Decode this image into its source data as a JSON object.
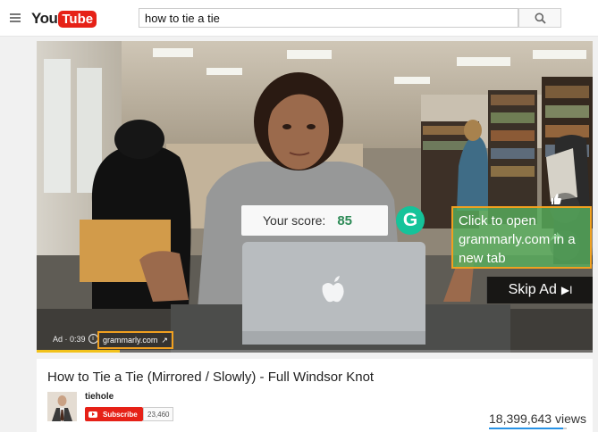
{
  "header": {
    "logo_you": "You",
    "logo_tube": "Tube",
    "search_value": "how to tie a tie"
  },
  "player": {
    "score_label": "Your score:",
    "score_value": "85",
    "grammarly_icon_letter": "G",
    "ad_cta_text": "Click to open grammarly.com in a new tab",
    "skip_label": "Skip Ad",
    "skip_arrow": "▶I",
    "ad_timer": "Ad · 0:39",
    "ad_url": "grammarly.com",
    "ad_progress": 0.15,
    "colors": {
      "progress": "#f2c21b",
      "highlight": "#f0a020",
      "grammarly": "#15c39a"
    }
  },
  "video": {
    "title": "How to Tie a Tie (Mirrored / Slowly) - Full Windsor Knot",
    "channel": "tiehole",
    "subscribe_label": "Subscribe",
    "subscriber_count": "23,460",
    "views": "18,399,643 views",
    "like_ratio": 0.95
  },
  "icons": [
    "menu-icon",
    "search-icon",
    "thumbs-up-icon",
    "share-icon",
    "info-icon",
    "external-link-icon",
    "youtube-play-icon"
  ]
}
